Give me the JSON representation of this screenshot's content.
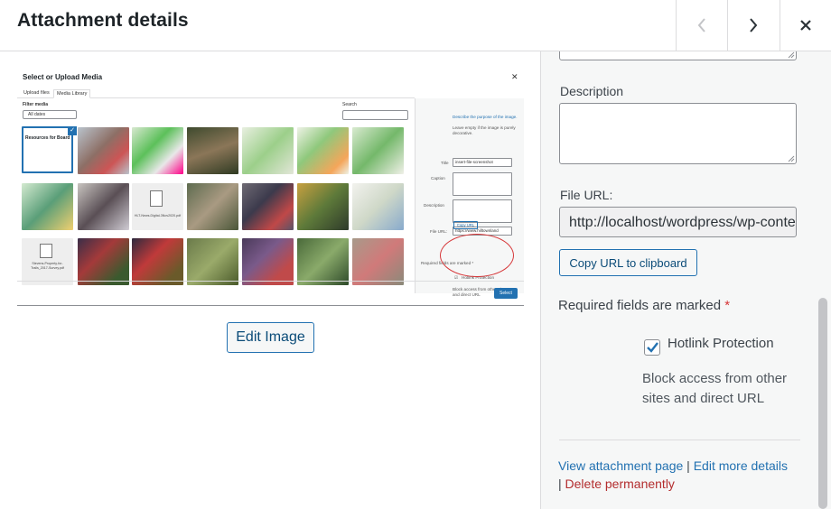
{
  "header": {
    "title": "Attachment details",
    "prev_icon": "chevron-left-icon",
    "next_icon": "chevron-right-icon",
    "close_icon": "close-icon"
  },
  "preview": {
    "modal_title": "Select or Upload Media",
    "tabs": [
      "Upload files",
      "Media Library"
    ],
    "filter_label": "Filter media",
    "filter_value": "All dates",
    "search_label": "Search",
    "thumb_caption_1": "Resources for Board",
    "thumb_caption_2": "HLT-News-Digital-3Nov2020.pdf",
    "thumb_caption_3": "Stevens-Property-for-Trails_2017-Survey.pdf",
    "side": {
      "describe_link": "Describe the purpose of the image.",
      "describe_hint": "Leave empty if the image is purely decorative.",
      "title_label": "Title",
      "title_value": "insert-file-screenshot",
      "caption_label": "Caption",
      "description_label": "Description",
      "file_url_label": "File URL:",
      "file_url_value": "https://www.hilltownland",
      "copy_url": "Copy URL",
      "required": "Required fields are marked *",
      "hotlink": "Hotlink Protection",
      "hotlink_desc": "Block access from other sites and direct URL"
    },
    "select_button": "Select"
  },
  "edit_image_button": "Edit Image",
  "sidebar": {
    "description_label": "Description",
    "description_value": "",
    "file_url_label": "File URL:",
    "file_url_value": "http://localhost/wordpress/wp-content/uploads/insert-file-screenshot.png",
    "copy_url_button": "Copy URL to clipboard",
    "required_text": "Required fields are marked",
    "required_star": "*",
    "hotlink_label": "Hotlink Protection",
    "hotlink_checked": true,
    "hotlink_desc": "Block access from other sites and direct URL",
    "links": {
      "view": "View attachment page",
      "sep1": "|",
      "edit": "Edit more details",
      "sep2": "|",
      "delete": "Delete permanently"
    }
  },
  "colors": {
    "accent": "#2271b1",
    "danger": "#d63638",
    "sidebar_bg": "#f6f7f7"
  }
}
